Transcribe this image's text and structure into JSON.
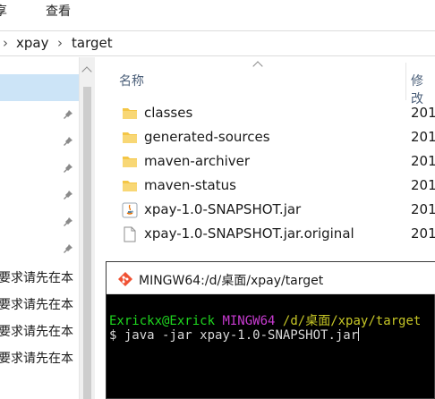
{
  "ribbon": {
    "share": "享",
    "view": "查看"
  },
  "address": {
    "crumbs": [
      "xpay",
      "target"
    ]
  },
  "nav": {
    "truncated_items": [
      "要求请先在本",
      "要求请先在本",
      "要求请先在本",
      "要求请先在本"
    ]
  },
  "list": {
    "col_name": "名称",
    "col_modified": "修改",
    "files": [
      {
        "name": "classes",
        "date": "201",
        "icon": "folder-icon"
      },
      {
        "name": "generated-sources",
        "date": "201",
        "icon": "folder-icon"
      },
      {
        "name": "maven-archiver",
        "date": "201",
        "icon": "folder-icon"
      },
      {
        "name": "maven-status",
        "date": "201",
        "icon": "folder-icon"
      },
      {
        "name": "xpay-1.0-SNAPSHOT.jar",
        "date": "201",
        "icon": "java-jar-icon"
      },
      {
        "name": "xpay-1.0-SNAPSHOT.jar.original",
        "date": "201",
        "icon": "file-icon"
      }
    ]
  },
  "terminal": {
    "title": "MINGW64:/d/桌面/xpay/target",
    "user": "Exrickx@Exrick",
    "system": "MINGW64",
    "path": "/d/桌面/xpay/target",
    "prompt": "$",
    "command": "java -jar xpay-1.0-SNAPSHOT.jar"
  },
  "colors": {
    "folder": "#f4c646",
    "selection": "#cce4f7",
    "term_green": "#1fd71f",
    "term_purple": "#c83bd1",
    "term_yellow": "#c6c626"
  }
}
